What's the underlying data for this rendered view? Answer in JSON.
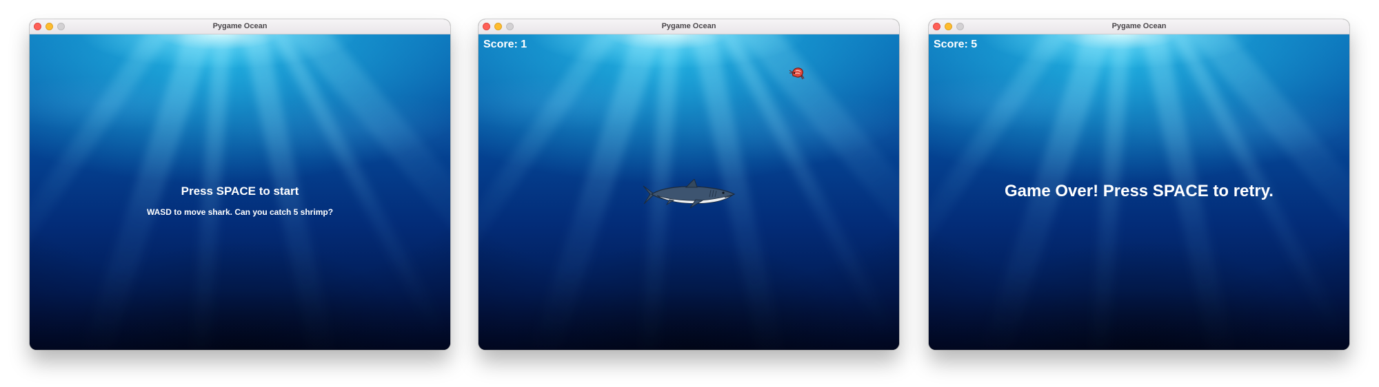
{
  "colors": {
    "ocean_surface": "#0a6fb8",
    "ocean_deep": "#010a24",
    "text": "#ffffff",
    "shark_body": "#3d5470",
    "shark_belly": "#eef1f4",
    "shrimp": "#e04a3f"
  },
  "windows": [
    {
      "title": "Pygame Ocean",
      "screen": "start",
      "start_title": "Press SPACE to start",
      "start_hint": "WASD to move shark. Can you catch 5 shrimp?"
    },
    {
      "title": "Pygame Ocean",
      "screen": "playing",
      "score_text": "Score: 1",
      "sprites": [
        "shark-sprite",
        "shrimp-sprite"
      ]
    },
    {
      "title": "Pygame Ocean",
      "screen": "game-over",
      "score_text": "Score: 5",
      "message": "Game Over! Press SPACE to retry."
    }
  ]
}
